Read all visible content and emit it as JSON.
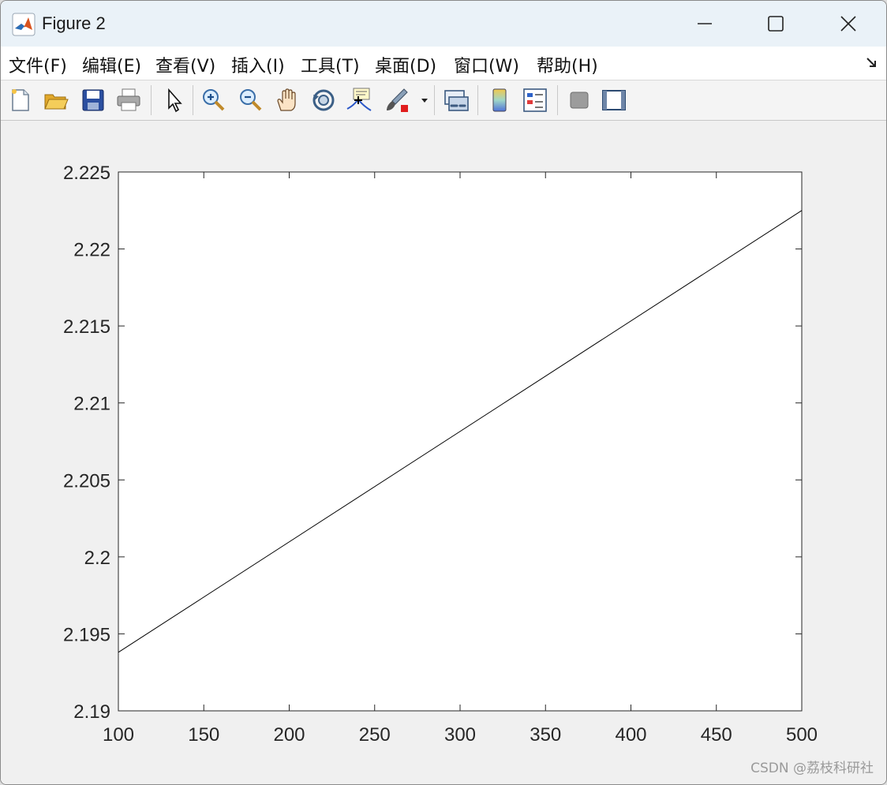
{
  "window": {
    "title": "Figure 2"
  },
  "menu": {
    "items": [
      "文件(F)",
      "编辑(E)",
      "查看(V)",
      "插入(I)",
      "工具(T)",
      "桌面(D)",
      "窗口(W)",
      "帮助(H)"
    ]
  },
  "toolbar": {
    "buttons": [
      "new-figure-icon",
      "open-icon",
      "save-icon",
      "print-icon",
      "select-arrow-icon",
      "zoom-in-icon",
      "zoom-out-icon",
      "pan-hand-icon",
      "rotate-3d-icon",
      "data-cursor-icon",
      "brush-icon",
      "link-plot-icon",
      "colorbar-icon",
      "legend-icon",
      "hide-plot-tools-icon",
      "show-plot-tools-icon"
    ]
  },
  "chart_data": {
    "type": "line",
    "title": "",
    "xlabel": "",
    "ylabel": "",
    "xlim": [
      100,
      500
    ],
    "ylim": [
      2.19,
      2.225
    ],
    "xticks": [
      "100",
      "150",
      "200",
      "250",
      "300",
      "350",
      "400",
      "450",
      "500"
    ],
    "yticks": [
      "2.19",
      "2.195",
      "2.2",
      "2.205",
      "2.21",
      "2.215",
      "2.22",
      "2.225"
    ],
    "grid": false,
    "series": [
      {
        "color": "#000000",
        "x": [
          100,
          500
        ],
        "y": [
          2.1938,
          2.2225
        ]
      }
    ]
  },
  "watermark": "CSDN @荔枝科研社"
}
